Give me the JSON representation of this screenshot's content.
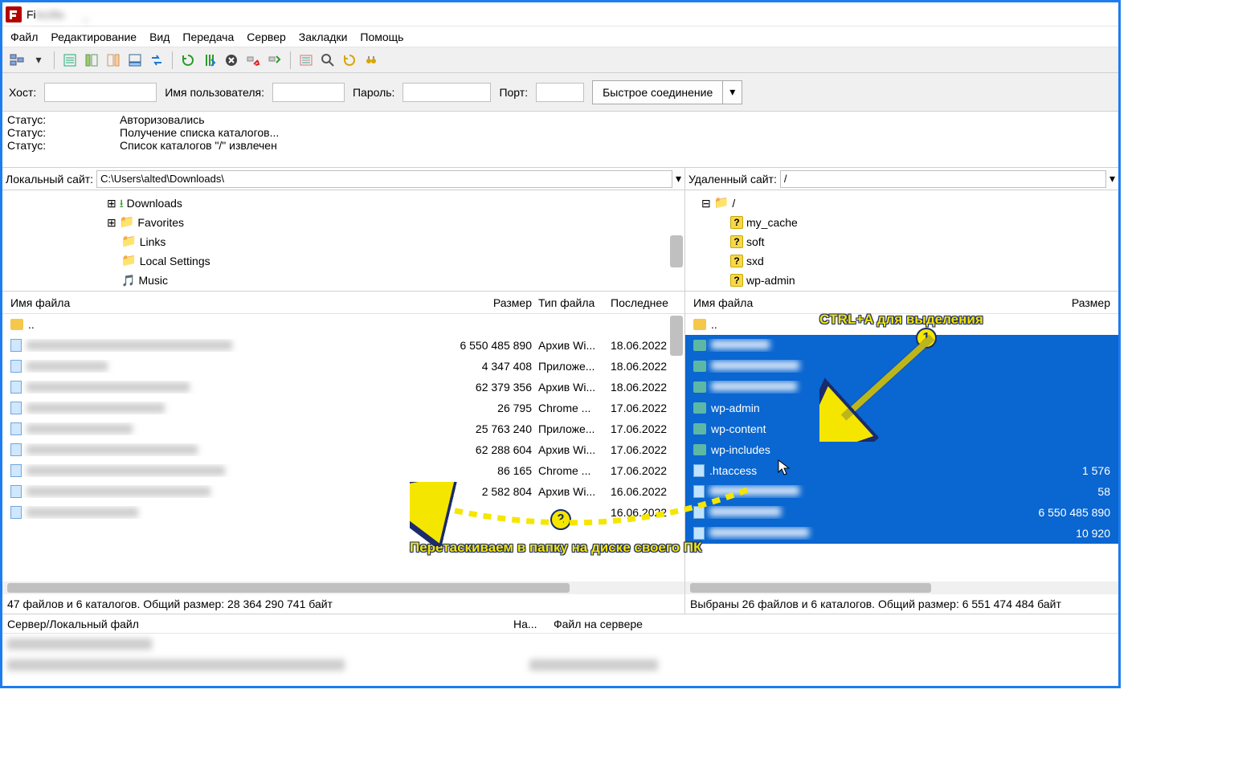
{
  "title_prefix": "Fi",
  "menu": {
    "file": "Файл",
    "edit": "Редактирование",
    "view": "Вид",
    "transfer": "Передача",
    "server": "Сервер",
    "bookmarks": "Закладки",
    "help": "Помощь"
  },
  "quick": {
    "host": "Хост:",
    "user": "Имя пользователя:",
    "pass": "Пароль:",
    "port": "Порт:",
    "connect": "Быстрое соединение"
  },
  "status_label": "Статус:",
  "status": [
    "Авторизовались",
    "Получение списка каталогов...",
    "Список каталогов \"/\" извлечен"
  ],
  "local": {
    "label": "Локальный сайт:",
    "path": "C:\\Users\\alted\\Downloads\\",
    "tree": [
      "Downloads",
      "Favorites",
      "Links",
      "Local Settings",
      "Music"
    ],
    "cols": {
      "name": "Имя файла",
      "size": "Размер",
      "type": "Тип файла",
      "date": "Последнее"
    },
    "parent": "..",
    "rows": [
      {
        "size": "6 550 485 890",
        "type": "Архив Wi...",
        "date": "18.06.2022"
      },
      {
        "size": "4 347 408",
        "type": "Приложе...",
        "date": "18.06.2022"
      },
      {
        "size": "62 379 356",
        "type": "Архив Wi...",
        "date": "18.06.2022"
      },
      {
        "size": "26 795",
        "type": "Chrome ...",
        "date": "17.06.2022"
      },
      {
        "size": "25 763 240",
        "type": "Приложе...",
        "date": "17.06.2022"
      },
      {
        "size": "62 288 604",
        "type": "Архив Wi...",
        "date": "17.06.2022"
      },
      {
        "size": "86 165",
        "type": "Chrome ...",
        "date": "17.06.2022"
      },
      {
        "size": "2 582 804",
        "type": "Архив Wi...",
        "date": "16.06.2022"
      },
      {
        "size": "",
        "type": "",
        "date": "16.06.2022"
      }
    ],
    "summary": "47 файлов и 6 каталогов. Общий размер: 28 364 290 741 байт"
  },
  "remote": {
    "label": "Удаленный сайт:",
    "path": "/",
    "tree_root": "/",
    "tree": [
      "my_cache",
      "soft",
      "sxd",
      "wp-admin"
    ],
    "cols": {
      "name": "Имя файла",
      "size": "Размер"
    },
    "parent": "..",
    "rows": [
      {
        "name": "",
        "kind": "folder",
        "size": ""
      },
      {
        "name": "",
        "kind": "folder",
        "size": ""
      },
      {
        "name": "",
        "kind": "folder",
        "size": ""
      },
      {
        "name": "wp-admin",
        "kind": "folder",
        "size": ""
      },
      {
        "name": "wp-content",
        "kind": "folder",
        "size": ""
      },
      {
        "name": "wp-includes",
        "kind": "folder",
        "size": ""
      },
      {
        "name": ".htaccess",
        "kind": "file",
        "size": "1 576"
      },
      {
        "name": "",
        "kind": "file",
        "size": "58"
      },
      {
        "name": "",
        "kind": "file",
        "size": "6 550 485 890"
      },
      {
        "name": "",
        "kind": "file",
        "size": "10 920"
      }
    ],
    "summary": "Выбраны 26 файлов и 6 каталогов. Общий размер: 6 551 474 484 байт"
  },
  "queue": {
    "c1": "Сервер/Локальный файл",
    "c2": "На...",
    "c3": "Файл на сервере"
  },
  "anno": {
    "a1": "CTRL+A для выделения",
    "a2": "Перетаскиваем в папку на диске своего ПК",
    "n1": "1",
    "n2": "2"
  }
}
